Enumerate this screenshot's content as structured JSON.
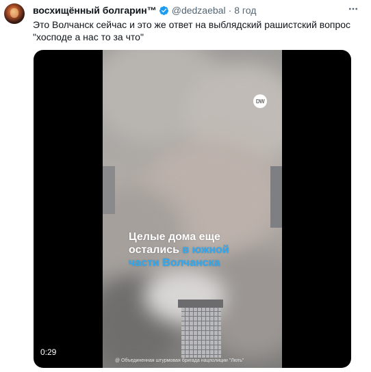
{
  "tweet": {
    "author_name": "восхищённый болгарин™",
    "handle": "@dedzaebal",
    "separator": "·",
    "time": "8 год",
    "text_lines": [
      "Это Волчанск сейчас и это же ответ на выблядский рашистский вопрос",
      "\"хосподе а нас то за что\""
    ],
    "more_icon": "more-horizontal-icon",
    "verified_color": "#1d9bf0"
  },
  "media": {
    "caption_line1": "Целые дома еще",
    "caption_line2_white": "остались ",
    "caption_line2_blue": "в южной",
    "caption_line3": "части Волчанска",
    "watermark": "DW",
    "credit": "@ Объединенная штурмовая бригада нацполиции \"Лють\"",
    "duration": "0:29",
    "accent_color": "#2ca9f2"
  }
}
